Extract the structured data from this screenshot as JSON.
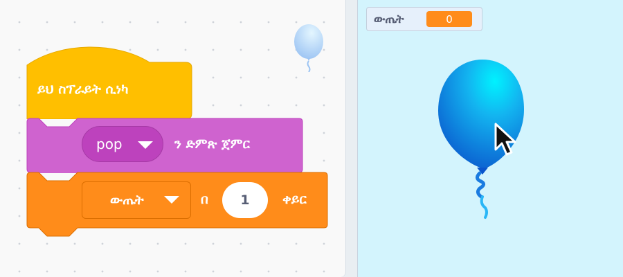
{
  "code_area": {
    "hat_block": {
      "text": "ይህ ስፕራይት ሲነካ"
    },
    "sound_block": {
      "dropdown_value": "pop",
      "text": "ን ድምጽ ጀምር"
    },
    "var_block": {
      "variable": "ውጤት",
      "by_text": "በ",
      "value": "1",
      "change_text": "ቀይር"
    },
    "colors": {
      "events": "#ffbf00",
      "sound": "#cf63cf",
      "variables": "#ff8c1a"
    }
  },
  "stage": {
    "monitor": {
      "label": "ውጤት",
      "value": "0"
    },
    "background": "#d3f4fd",
    "sprite": "balloon-icon"
  },
  "icons": [
    "dropdown-caret-icon",
    "balloon-icon",
    "mouse-cursor-icon"
  ]
}
